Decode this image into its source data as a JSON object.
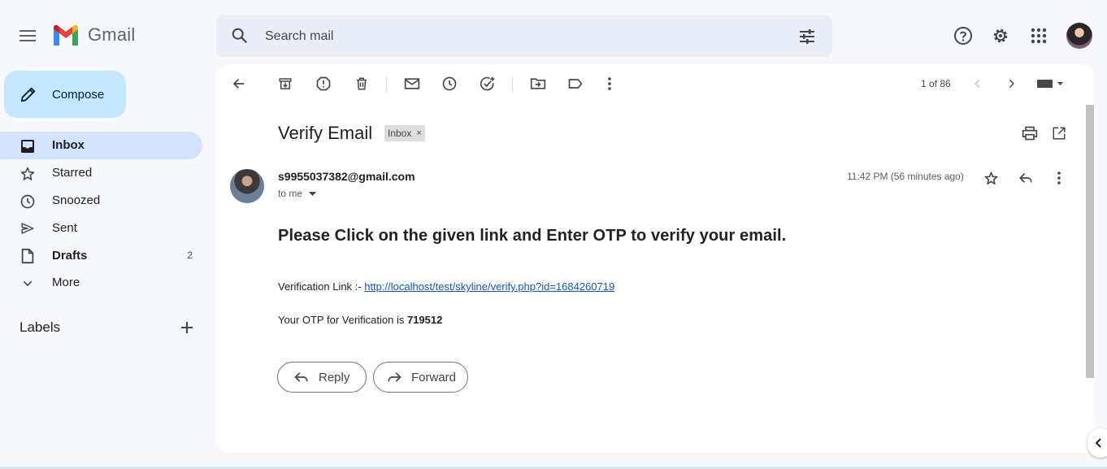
{
  "header": {
    "app_name": "Gmail",
    "search_placeholder": "Search mail"
  },
  "sidebar": {
    "compose_label": "Compose",
    "items": [
      {
        "label": "Inbox",
        "count": "",
        "icon": "inbox-icon"
      },
      {
        "label": "Starred",
        "count": "",
        "icon": "star-icon"
      },
      {
        "label": "Snoozed",
        "count": "",
        "icon": "clock-icon"
      },
      {
        "label": "Sent",
        "count": "",
        "icon": "send-icon"
      },
      {
        "label": "Drafts",
        "count": "2",
        "icon": "draft-icon"
      },
      {
        "label": "More",
        "count": "",
        "icon": "chevron-down-icon"
      }
    ],
    "labels_heading": "Labels"
  },
  "toolbar": {
    "pager": "1 of 86"
  },
  "email": {
    "subject": "Verify Email",
    "chip": "Inbox",
    "chip_close": "×",
    "sender": "s9955037382@gmail.com",
    "recipient": "to me",
    "time": "11:42 PM (56 minutes ago)",
    "headline": "Please Click on the given link and Enter OTP to verify your email.",
    "verification_prefix": "Verification Link :- ",
    "verification_link": "http://localhost/test/skyline/verify.php?id=1684260719",
    "otp_prefix": "Your OTP for Verification is ",
    "otp_code": "719512",
    "reply_label": "Reply",
    "forward_label": "Forward"
  },
  "colors": {
    "page_bg": "#f6f8fc",
    "compose_bg": "#c2e7ff",
    "active_nav_bg": "#d3e3fd",
    "search_bg": "#e9eef6",
    "link": "#1155cc"
  }
}
